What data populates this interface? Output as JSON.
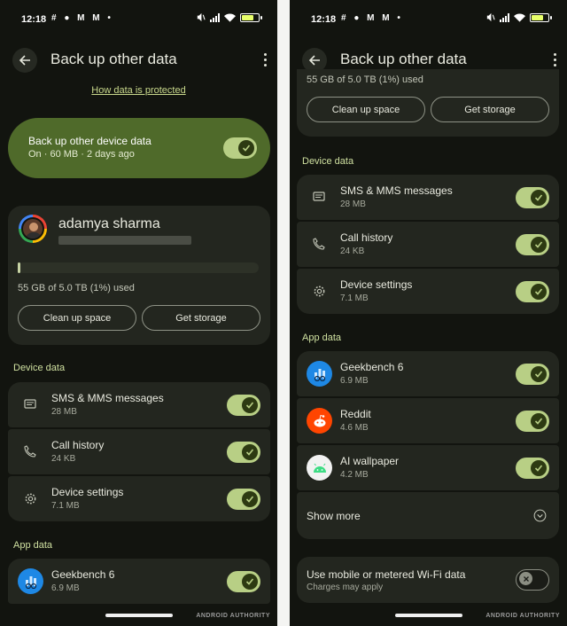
{
  "status": {
    "time": "12:18",
    "notif_icons": "# ● M M •"
  },
  "header": {
    "title": "Back up other data"
  },
  "protection_link": "How data is protected",
  "backup_toggle": {
    "title": "Back up other device data",
    "subtitle": "On · 60 MB · 2 days ago",
    "on": true
  },
  "account": {
    "name": "adamya sharma",
    "storage_used_percent": 1,
    "storage_text": "55 GB of 5.0 TB (1%) used"
  },
  "storage_actions": {
    "clean_up": "Clean up space",
    "get_storage": "Get storage"
  },
  "device_data": {
    "label": "Device data",
    "items": [
      {
        "title": "SMS & MMS messages",
        "size": "28 MB",
        "icon": "message-icon",
        "on": true
      },
      {
        "title": "Call history",
        "size": "24 KB",
        "icon": "phone-icon",
        "on": true
      },
      {
        "title": "Device settings",
        "size": "7.1 MB",
        "icon": "gear-icon",
        "on": true
      }
    ]
  },
  "app_data": {
    "label": "App data",
    "items": [
      {
        "title": "Geekbench 6",
        "size": "6.9 MB",
        "icon": "geekbench-icon",
        "on": true
      },
      {
        "title": "Reddit",
        "size": "4.6 MB",
        "icon": "reddit-icon",
        "on": true
      },
      {
        "title": "AI wallpaper",
        "size": "4.2 MB",
        "icon": "android-icon",
        "on": true
      }
    ],
    "show_more": "Show more"
  },
  "metered": {
    "title": "Use mobile or metered Wi-Fi data",
    "subtitle": "Charges may apply",
    "on": false
  },
  "watermark": "ANDROID AUTHORITY",
  "colors": {
    "accent": "#b8cf85",
    "hero_bg": "#4f6a2a",
    "card_bg": "#23261f",
    "page_bg": "#12140f"
  }
}
